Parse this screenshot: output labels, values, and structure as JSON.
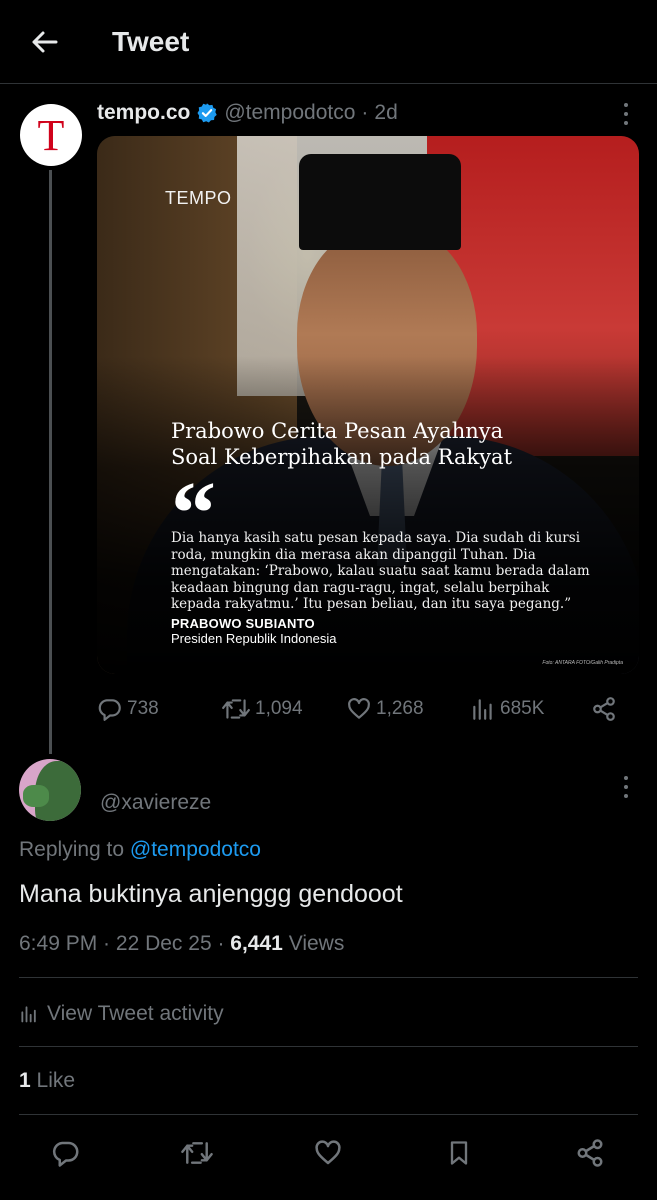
{
  "header": {
    "title": "Tweet",
    "back_icon": "arrow-left-icon"
  },
  "original_tweet": {
    "author_name": "tempo.co",
    "author_handle": "@tempodotco",
    "separator": "·",
    "time": "2d",
    "avatar_letter": "T",
    "media": {
      "brand": "TEMPO",
      "headline_line1": "Prabowo Cerita Pesan Ayahnya",
      "headline_line2": "Soal Keberpihakan pada Rakyat",
      "quote_mark": "“",
      "quote_line1": "Dia hanya kasih satu pesan kepada saya. Dia sudah di kursi",
      "quote_line2": "roda, mungkin dia merasa akan dipanggil Tuhan. Dia",
      "quote_line3": "mengatakan: ‘Prabowo, kalau suatu saat kamu berada dalam",
      "quote_line4": "keadaan bingung dan ragu-ragu, ingat, selalu berpihak",
      "quote_line5": "kepada rakyatmu.’ Itu pesan beliau, dan itu saya pegang.”",
      "speaker": "PRABOWO SUBIANTO",
      "speaker_role": "Presiden Republik Indonesia",
      "photo_credit": "Foto: ANTARA FOTO/Galih Pradipta"
    },
    "stats": {
      "replies": "738",
      "retweets": "1,094",
      "likes": "1,268",
      "views": "685K"
    }
  },
  "reply_tweet": {
    "author_handle": "@xaviereze",
    "replying_prefix": "Replying to",
    "replying_to": "@tempodotco",
    "text": "Mana buktinya anjenggg gendooot",
    "time": "6:49 PM",
    "sep1": " · ",
    "date": "22 Dec 25",
    "sep2": " · ",
    "views_count": "6,441",
    "views_label": " Views",
    "activity_label": "View Tweet activity",
    "likes_count": "1",
    "likes_label": " Like"
  },
  "colors": {
    "background": "#000000",
    "text": "#e7e9ea",
    "muted": "#71767b",
    "link": "#1d9bf0",
    "verified": "#1d9bf0",
    "divider": "#2f3336"
  }
}
